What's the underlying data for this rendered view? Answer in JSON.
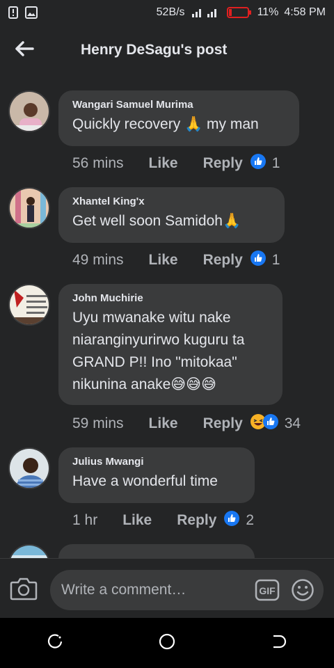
{
  "status_bar": {
    "speed": "52B/s",
    "battery": "11%",
    "time": "4:58 PM"
  },
  "header": {
    "title": "Henry DeSagu's post",
    "back_icon": "arrow-left-icon"
  },
  "comments": [
    {
      "author": "Wangari Samuel Murima",
      "text": "Quickly recovery 🙏 my man",
      "time": "56 mins",
      "like": "Like",
      "reply": "Reply",
      "reactions": [
        "like"
      ],
      "count": "1"
    },
    {
      "author": "Xhantel King'x",
      "text": "Get well soon  Samidoh🙏",
      "time": "49 mins",
      "like": "Like",
      "reply": "Reply",
      "reactions": [
        "like"
      ],
      "count": "1"
    },
    {
      "author": "John Muchirie",
      "text": "Uyu mwanake witu nake niaranginyurirwo kuguru ta GRAND P!! Ino \"mitokaa\" nikunina anake😅😅😅",
      "time": "59 mins",
      "like": "Like",
      "reply": "Reply",
      "reactions": [
        "haha",
        "like"
      ],
      "count": "34"
    },
    {
      "author": "Julius Mwangi",
      "text": "Have a wonderful time",
      "time": "1 hr",
      "like": "Like",
      "reply": "Reply",
      "reactions": [
        "like"
      ],
      "count": "2"
    }
  ],
  "composer": {
    "placeholder": "Write a comment…",
    "gif_label": "GIF",
    "icons": [
      "camera-icon",
      "gif-icon",
      "emoji-icon"
    ]
  },
  "colors": {
    "background": "#242526",
    "bubble": "#3a3b3c",
    "text": "#e4e6eb",
    "secondary": "#b0b3b8",
    "like_blue": "#1877f2",
    "haha_yellow": "#f7b125"
  }
}
